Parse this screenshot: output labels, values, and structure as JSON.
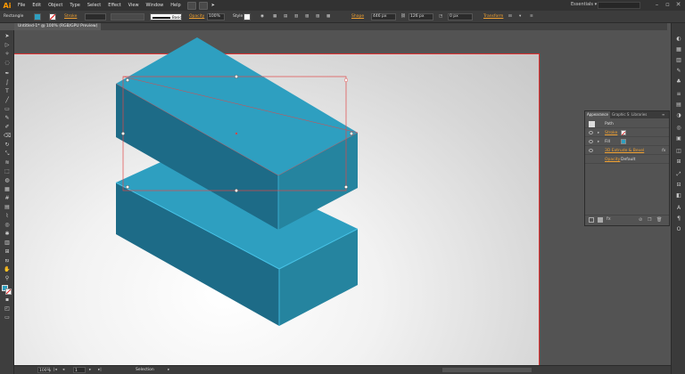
{
  "app": {
    "logo": "Ai",
    "workspace": "Essentials ▾"
  },
  "menu": [
    "File",
    "Edit",
    "Object",
    "Type",
    "Select",
    "Effect",
    "View",
    "Window",
    "Help"
  ],
  "control": {
    "object_type": "Rectangle",
    "stroke_label": "Stroke",
    "brush_label": "Basic",
    "opacity_label": "Opacity",
    "opacity_value": "100%",
    "style_label": "Style",
    "shape_label": "Shape",
    "width_value": "446 px",
    "height_value": "126 px",
    "corner_value": "0 px",
    "transform_label": "Transform",
    "fill_color": "#2e9fc0"
  },
  "doc_tab": "Untitled-1* @ 100% (RGB/GPU Preview)",
  "panel": {
    "tabs": [
      "Appearance",
      "Graphic S",
      "Libraries"
    ],
    "title": "Path",
    "rows": [
      {
        "label": "Stroke",
        "type": "stroke"
      },
      {
        "label": "Fill",
        "type": "fill"
      },
      {
        "label": "3D Extrude & Bevel",
        "type": "effect",
        "fx": "fx"
      },
      {
        "label": "Opacity",
        "value": "Default",
        "type": "opacity"
      }
    ]
  },
  "status": {
    "zoom": "100%",
    "page": "1",
    "tool": "Selection"
  },
  "colors": {
    "accent": "#2e9fc0",
    "top_face": "#2e9fc0",
    "left_face": "#1d6b87",
    "right_face": "#25849f",
    "selection": "#e04848"
  }
}
